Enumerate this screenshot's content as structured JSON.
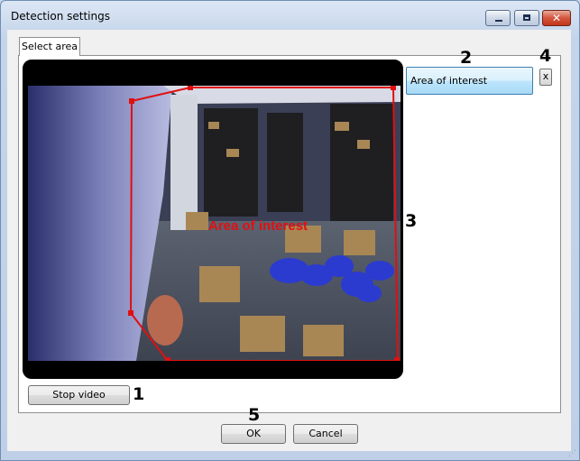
{
  "window": {
    "title": "Detection settings",
    "accent": "#c9d6ea"
  },
  "tabs": [
    {
      "label": "Select area"
    }
  ],
  "zones": {
    "selected": "Area of interest",
    "delete_label": "x"
  },
  "video": {
    "overlay_label": "Area of interest",
    "zone_color": "#e01010"
  },
  "buttons": {
    "stop_video": "Stop video",
    "ok": "OK",
    "cancel": "Cancel"
  },
  "callouts": {
    "c1": "1",
    "c2": "2",
    "c3": "3",
    "c4": "4",
    "c5": "5"
  }
}
